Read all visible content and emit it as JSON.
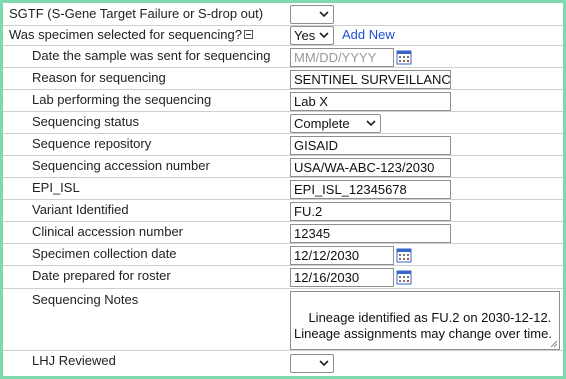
{
  "rows": {
    "sgtf": {
      "label": "SGTF (S-Gene Target Failure or S-drop out)",
      "value": ""
    },
    "selected": {
      "label": "Was specimen selected for sequencing?",
      "value": "Yes",
      "add_new": "Add New"
    },
    "date_sent": {
      "label": "Date the sample was sent for sequencing",
      "placeholder": "MM/DD/YYYY",
      "value": ""
    },
    "reason": {
      "label": "Reason for sequencing",
      "value": "SENTINEL SURVEILLANC"
    },
    "lab": {
      "label": "Lab performing the sequencing",
      "value": "Lab X"
    },
    "status": {
      "label": "Sequencing status",
      "value": "Complete"
    },
    "repository": {
      "label": "Sequence repository",
      "value": "GISAID"
    },
    "accession": {
      "label": "Sequencing accession number",
      "value": "USA/WA-ABC-123/2030"
    },
    "epi_isl": {
      "label": "EPI_ISL",
      "value": "EPI_ISL_12345678"
    },
    "variant": {
      "label": "Variant Identified",
      "value": "FU.2"
    },
    "clinical": {
      "label": "Clinical accession number",
      "value": "12345"
    },
    "collection_date": {
      "label": "Specimen collection date",
      "value": "12/12/2030"
    },
    "roster_date": {
      "label": "Date prepared for roster",
      "value": "12/16/2030"
    },
    "notes": {
      "label": "Sequencing Notes",
      "value": "Lineage identified as FU.2 on 2030-12-12.\nLineage assignments may change over time."
    },
    "lhj": {
      "label": "LHJ Reviewed",
      "value": ""
    }
  },
  "icons": {
    "calendar": "calendar-icon",
    "collapse": "collapse-minus-icon",
    "dropdown": "chevron-down-icon",
    "resize": "resize-grip-icon"
  },
  "colors": {
    "frame": "#7fd9ae",
    "link": "#1f4fd1",
    "calendar_blue": "#3a64c8",
    "calendar_red": "#c0392b"
  }
}
